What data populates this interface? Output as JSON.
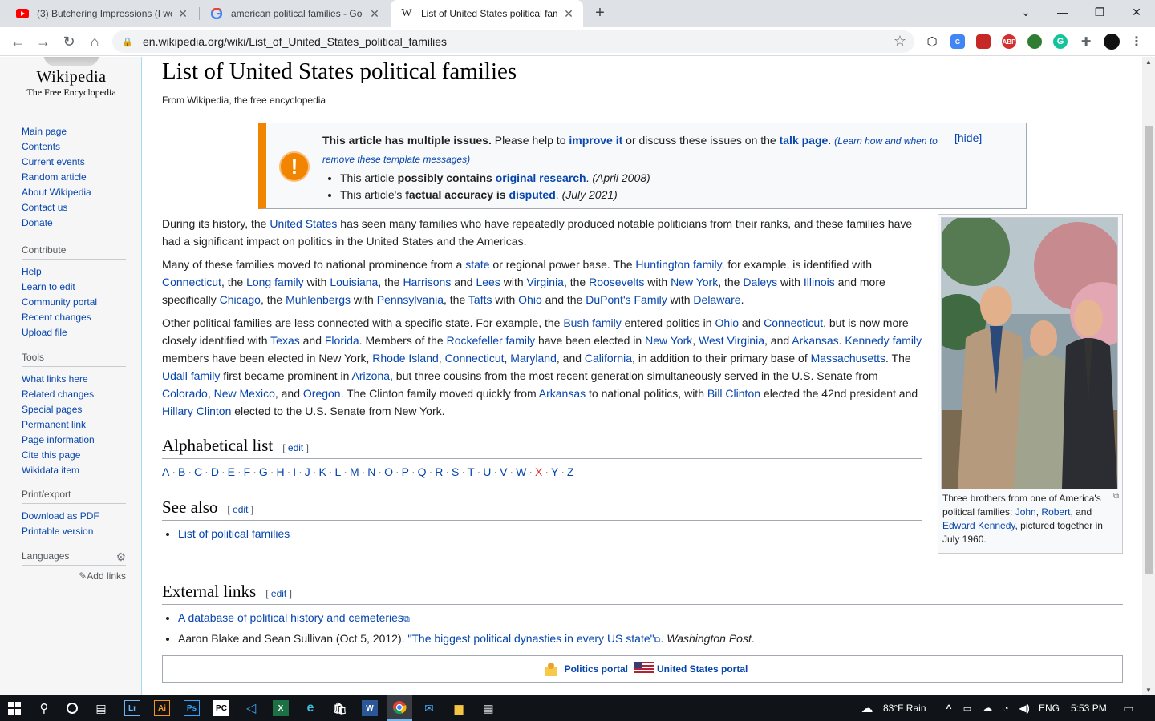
{
  "browser": {
    "tabs": [
      {
        "title": "(3) Butchering Impressions (I wor",
        "favicon": "youtube-icon"
      },
      {
        "title": "american political families - Goog",
        "favicon": "google-icon"
      },
      {
        "title": "List of United States political fam",
        "favicon": "wikipedia-icon"
      }
    ],
    "new_tab": "+",
    "url": "en.wikipedia.org/wiki/List_of_United_States_political_families",
    "extensions": [
      "abp-icon",
      "grammarly-icon",
      "puzzle-icon"
    ]
  },
  "wiki": {
    "logo_word": "Wikipedia",
    "logo_tagline": "The Free Encyclopedia",
    "nav": [
      "Main page",
      "Contents",
      "Current events",
      "Random article",
      "About Wikipedia",
      "Contact us",
      "Donate"
    ],
    "contribute_title": "Contribute",
    "contribute": [
      "Help",
      "Learn to edit",
      "Community portal",
      "Recent changes",
      "Upload file"
    ],
    "tools_title": "Tools",
    "tools": [
      "What links here",
      "Related changes",
      "Special pages",
      "Permanent link",
      "Page information",
      "Cite this page",
      "Wikidata item"
    ],
    "print_title": "Print/export",
    "print": [
      "Download as PDF",
      "Printable version"
    ],
    "languages_title": "Languages",
    "add_links": "Add links"
  },
  "article": {
    "title": "List of United States political families",
    "site_sub": "From Wikipedia, the free encyclopedia",
    "ambox": {
      "bold": "This article has multiple issues.",
      "t1": " Please help to ",
      "improve": "improve it",
      "t2": " or discuss these issues on the ",
      "talk": "talk page",
      "t3": ". ",
      "learn": "(Learn how and when to remove these template messages)",
      "hide": "[hide]",
      "issue1": {
        "a": "This article ",
        "b": "possibly contains ",
        "link": "original research",
        "c": ". ",
        "date": "(April 2008)"
      },
      "issue2": {
        "a": "This article's ",
        "b": "factual accuracy is ",
        "link": "disputed",
        "c": ". ",
        "date": "(July 2021)"
      }
    },
    "p1": [
      {
        "t": "During its history, the "
      },
      {
        "l": "United States"
      },
      {
        "t": " has seen many families who have repeatedly produced notable politicians from their ranks, and these families have had a significant impact on politics in the United States and the Americas."
      }
    ],
    "p2": [
      {
        "t": "Many of these families moved to national prominence from a "
      },
      {
        "l": "state"
      },
      {
        "t": " or regional power base. The "
      },
      {
        "l": "Huntington family"
      },
      {
        "t": ", for example, is identified with "
      },
      {
        "l": "Connecticut"
      },
      {
        "t": ", the "
      },
      {
        "l": "Long family"
      },
      {
        "t": " with "
      },
      {
        "l": "Louisiana"
      },
      {
        "t": ", the "
      },
      {
        "l": "Harrisons"
      },
      {
        "t": " and "
      },
      {
        "l": "Lees"
      },
      {
        "t": " with "
      },
      {
        "l": "Virginia"
      },
      {
        "t": ", the "
      },
      {
        "l": "Roosevelts"
      },
      {
        "t": " with "
      },
      {
        "l": "New York"
      },
      {
        "t": ", the "
      },
      {
        "l": "Daleys"
      },
      {
        "t": " with "
      },
      {
        "l": "Illinois"
      },
      {
        "t": " and more specifically "
      },
      {
        "l": "Chicago"
      },
      {
        "t": ", the "
      },
      {
        "l": "Muhlenbergs"
      },
      {
        "t": " with "
      },
      {
        "l": "Pennsylvania"
      },
      {
        "t": ", the "
      },
      {
        "l": "Tafts"
      },
      {
        "t": " with "
      },
      {
        "l": "Ohio"
      },
      {
        "t": " and the "
      },
      {
        "l": "DuPont's Family"
      },
      {
        "t": " with "
      },
      {
        "l": "Delaware"
      },
      {
        "t": "."
      }
    ],
    "p3": [
      {
        "t": "Other political families are less connected with a specific state. For example, the "
      },
      {
        "l": "Bush family"
      },
      {
        "t": " entered politics in "
      },
      {
        "l": "Ohio"
      },
      {
        "t": " and "
      },
      {
        "l": "Connecticut"
      },
      {
        "t": ", but is now more closely identified with "
      },
      {
        "l": "Texas"
      },
      {
        "t": " and "
      },
      {
        "l": "Florida"
      },
      {
        "t": ". Members of the "
      },
      {
        "l": "Rockefeller family"
      },
      {
        "t": " have been elected in "
      },
      {
        "l": "New York"
      },
      {
        "t": ", "
      },
      {
        "l": "West Virginia"
      },
      {
        "t": ", and "
      },
      {
        "l": "Arkansas"
      },
      {
        "t": ". "
      },
      {
        "l": "Kennedy family"
      },
      {
        "t": " members have been elected in New York, "
      },
      {
        "l": "Rhode Island"
      },
      {
        "t": ", "
      },
      {
        "l": "Connecticut"
      },
      {
        "t": ", "
      },
      {
        "l": "Maryland"
      },
      {
        "t": ", and "
      },
      {
        "l": "California"
      },
      {
        "t": ", in addition to their primary base of "
      },
      {
        "l": "Massachusetts"
      },
      {
        "t": ". The "
      },
      {
        "l": "Udall family"
      },
      {
        "t": " first became prominent in "
      },
      {
        "l": "Arizona"
      },
      {
        "t": ", but three cousins from the most recent generation simultaneously served in the U.S. Senate from "
      },
      {
        "l": "Colorado"
      },
      {
        "t": ", "
      },
      {
        "l": "New Mexico"
      },
      {
        "t": ", and "
      },
      {
        "l": "Oregon"
      },
      {
        "t": ". The Clinton family moved quickly from "
      },
      {
        "l": "Arkansas"
      },
      {
        "t": " to national politics, with "
      },
      {
        "l": "Bill Clinton"
      },
      {
        "t": " elected the 42nd president and "
      },
      {
        "l": "Hillary Clinton"
      },
      {
        "t": " elected to the U.S. Senate from New York."
      }
    ],
    "thumb_caption": [
      {
        "t": "Three brothers from one of America's political families: "
      },
      {
        "l": "John"
      },
      {
        "t": ", "
      },
      {
        "l": "Robert"
      },
      {
        "t": ", and "
      },
      {
        "l": "Edward Kennedy"
      },
      {
        "t": ", pictured together in July 1960."
      }
    ],
    "h_alpha": "Alphabetical list",
    "letters": [
      "A",
      "B",
      "C",
      "D",
      "E",
      "F",
      "G",
      "H",
      "I",
      "J",
      "K",
      "L",
      "M",
      "N",
      "O",
      "P",
      "Q",
      "R",
      "S",
      "T",
      "U",
      "V",
      "W",
      "X",
      "Y",
      "Z"
    ],
    "h_see": "See also",
    "see_also": "List of political families",
    "h_ext": "External links",
    "edit_label": "edit",
    "ext1": "A database of political history and cemeteries",
    "ext2": {
      "pre": "Aaron Blake and Sean Sullivan (Oct 5, 2012). ",
      "link": "\"The biggest political dynasties in every US state\"",
      "post": ". ",
      "pub": "Washington Post",
      "end": "."
    },
    "portal_politics": "Politics portal",
    "portal_us": "United States portal"
  },
  "taskbar": {
    "weather": "83°F  Rain",
    "lang": "ENG",
    "time": "5:53 PM"
  },
  "colors": {
    "link": "#0645ad",
    "ambox_stripe": "#f28500",
    "redlink": "#d33"
  }
}
